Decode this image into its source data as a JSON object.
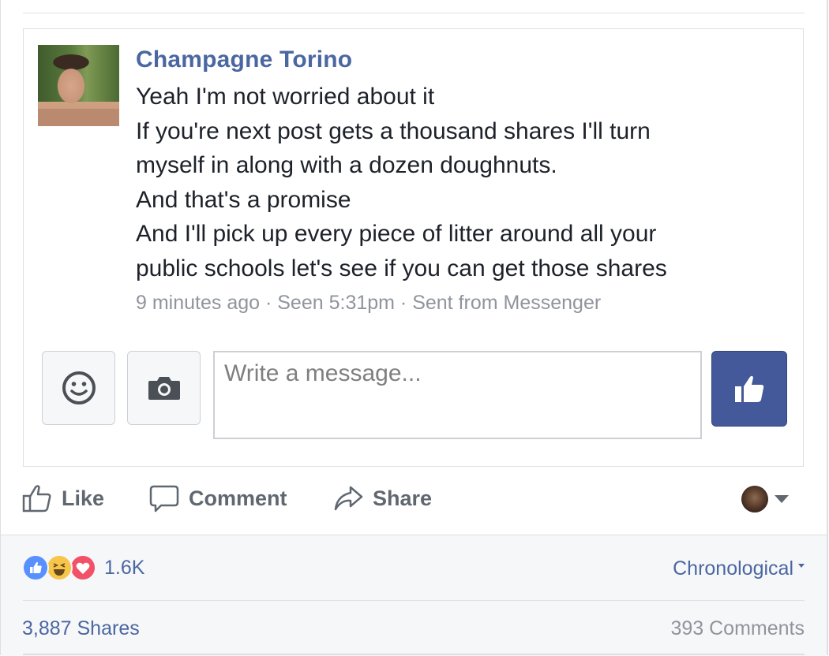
{
  "message": {
    "sender_name": "Champagne Torino",
    "lines": [
      "Yeah I'm not worried about it",
      "If you're next post gets a thousand shares I'll turn",
      "myself in along with a dozen doughnuts.",
      "And that's a promise",
      "And I'll pick up every piece of litter around all your",
      "public schools let's see if you can get those shares"
    ],
    "meta": "9 minutes ago · Seen 5:31pm · Sent from Messenger"
  },
  "composer": {
    "placeholder": "Write a message...",
    "icons": {
      "emoji": "smiley-icon",
      "camera": "camera-icon",
      "send": "thumbs-up-icon"
    }
  },
  "actions": {
    "like": "Like",
    "comment": "Comment",
    "share": "Share"
  },
  "summary": {
    "reactions": [
      "like",
      "haha",
      "love"
    ],
    "reaction_count": "1.6K",
    "sort": "Chronological",
    "shares": "3,887 Shares",
    "comments": "393 Comments"
  },
  "colors": {
    "name_link": "#4b67a1",
    "send_button": "#43599a",
    "like_reaction": "#5890ff",
    "haha_reaction": "#f7c54a",
    "love_reaction": "#f25268"
  }
}
